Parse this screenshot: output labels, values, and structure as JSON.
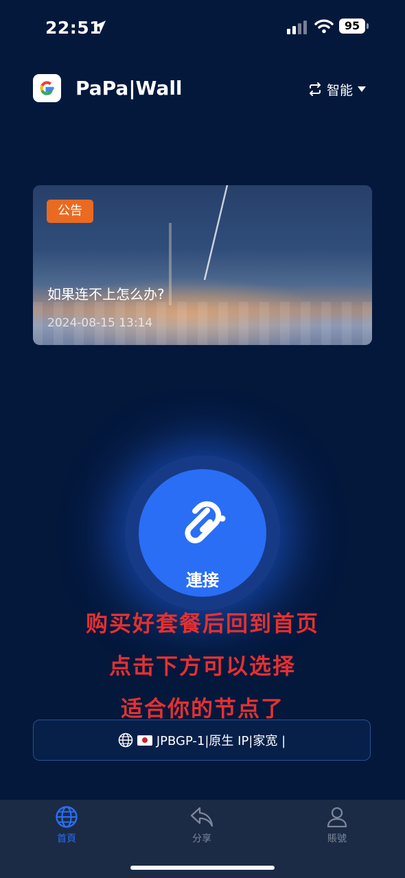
{
  "status_bar": {
    "time": "22:51",
    "battery": "95"
  },
  "header": {
    "app_title": "PaPa|Wall",
    "mode_label": "智能"
  },
  "notice": {
    "badge": "公告",
    "title": "如果连不上怎么办?",
    "date": "2024-08-15 13:14"
  },
  "connect": {
    "label": "連接"
  },
  "overlay_instructions": [
    "购买好套餐后回到首页",
    "点击下方可以选择",
    "适合你的节点了"
  ],
  "node_selector": {
    "node_name": "JPBGP-1|原生 IP|家宽 |"
  },
  "tab_bar": {
    "tabs": [
      {
        "label": "首頁",
        "icon": "globe-icon",
        "active": true
      },
      {
        "label": "分享",
        "icon": "share-icon",
        "active": false
      },
      {
        "label": "賬號",
        "icon": "user-icon",
        "active": false
      }
    ]
  },
  "colors": {
    "background": "#04183c",
    "accent": "#2a6ef5",
    "badge": "#ea6a21",
    "overlay_text": "#e53031",
    "tab_bar": "#1b2b45"
  }
}
